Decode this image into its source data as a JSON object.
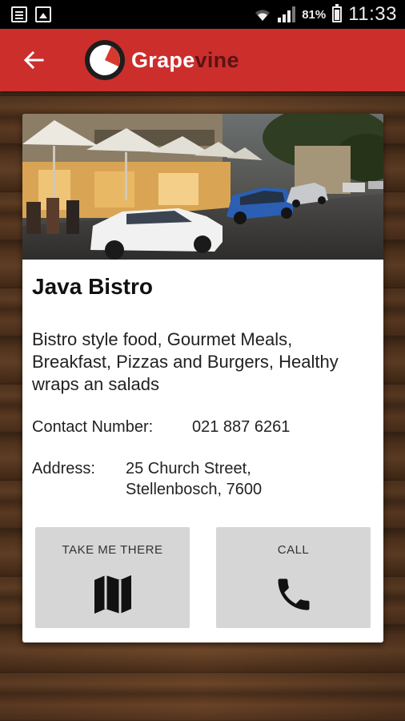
{
  "status_bar": {
    "battery": "81%",
    "time": "11:33"
  },
  "app_bar": {
    "logo_main": "Grape",
    "logo_accent": "vine"
  },
  "restaurant": {
    "name": "Java Bistro",
    "description": "Bistro style food, Gourmet Meals, Breakfast, Pizzas and Burgers, Healthy wraps an salads",
    "contact_label": "Contact Number:",
    "contact_value": "021 887 6261",
    "address_label": "Address:",
    "address_line1": "25 Church Street,",
    "address_line2": "Stellenbosch, 7600"
  },
  "actions": {
    "take_me_there": "TAKE ME THERE",
    "call": "CALL"
  },
  "colors": {
    "app_bar": "#cc2e2c",
    "card": "#ffffff",
    "action_bg": "#d6d6d6"
  },
  "icons": [
    "notes-icon",
    "image-icon",
    "wifi-icon",
    "signal-icon",
    "battery-icon",
    "back-arrow-icon",
    "map-icon",
    "phone-icon"
  ]
}
